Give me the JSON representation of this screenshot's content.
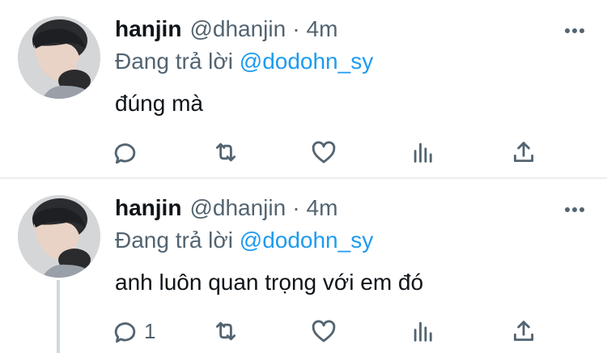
{
  "tweets": [
    {
      "name": "hanjin",
      "handle": "@dhanjin",
      "dot": "·",
      "time": "4m",
      "reply_prefix": "Đang trả lời",
      "reply_to": "@dodohn_sy",
      "text": "đúng mà",
      "reply_count": "",
      "icons": [
        "reply-icon",
        "retweet-icon",
        "like-icon",
        "analytics-icon",
        "share-icon",
        "more-icon"
      ]
    },
    {
      "name": "hanjin",
      "handle": "@dhanjin",
      "dot": "·",
      "time": "4m",
      "reply_prefix": "Đang trả lời",
      "reply_to": "@dodohn_sy",
      "text": "anh luôn quan trọng với em đó",
      "reply_count": "1",
      "icons": [
        "reply-icon",
        "retweet-icon",
        "like-icon",
        "analytics-icon",
        "share-icon",
        "more-icon"
      ]
    }
  ],
  "colors": {
    "accent": "#1d9bf0",
    "secondary_text": "#536471",
    "divider": "#ebeef0"
  }
}
